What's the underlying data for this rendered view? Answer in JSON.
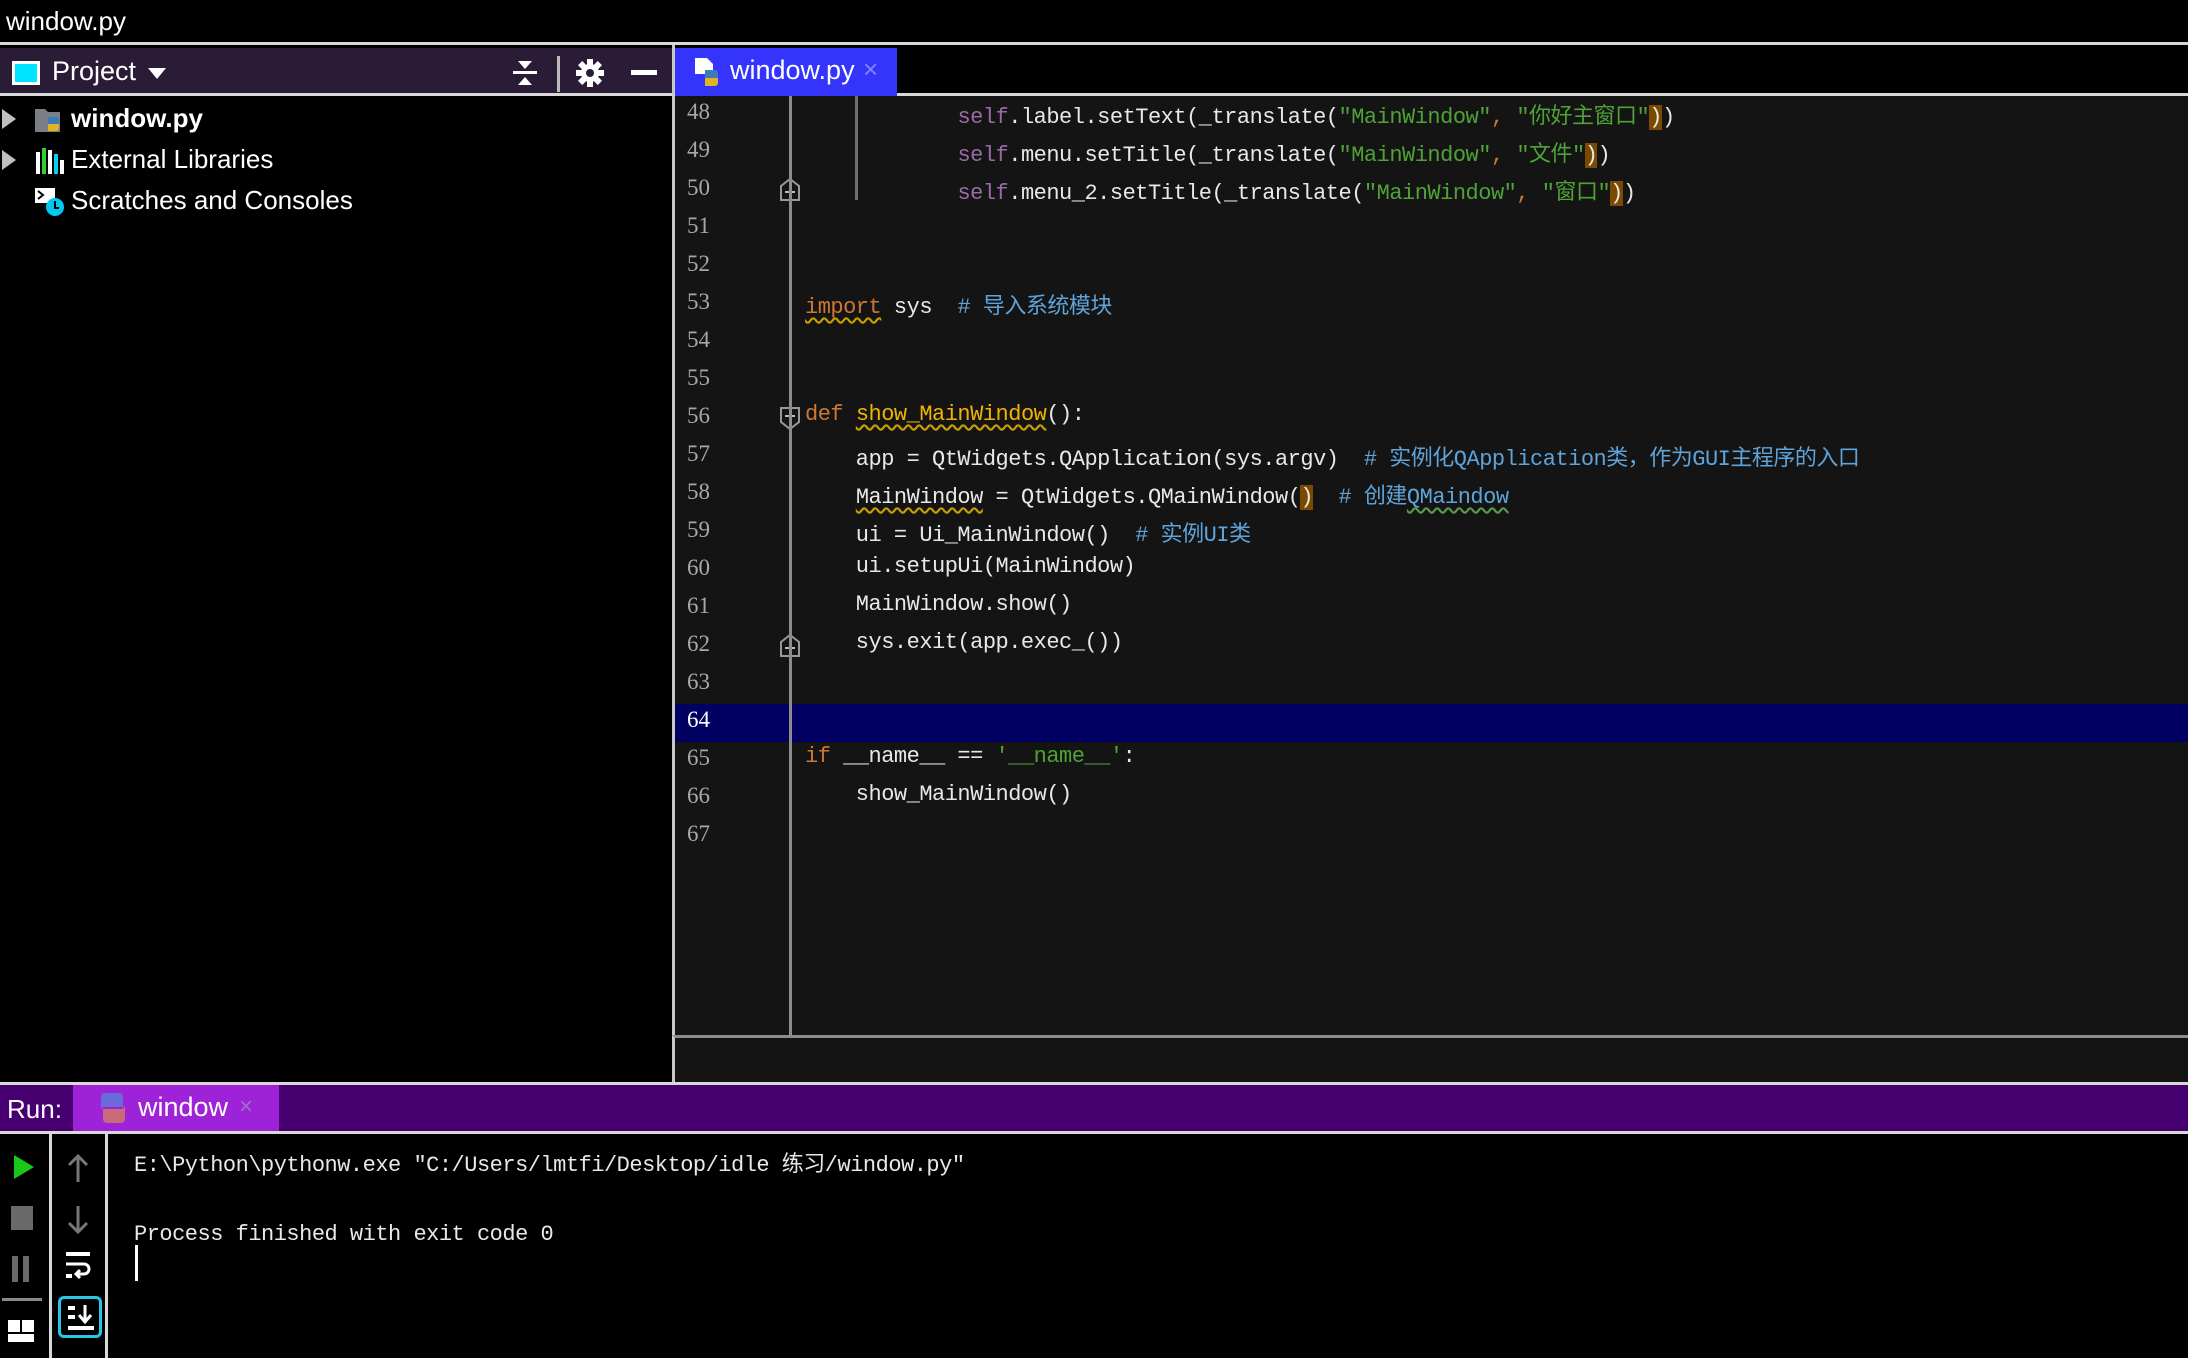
{
  "window": {
    "title": "window.py"
  },
  "project_panel": {
    "title": "Project",
    "icons": {
      "view": "project-view-icon",
      "dropdown": "chevron-down-icon",
      "collapse": "collapse-all-icon",
      "settings": "gear-icon",
      "hide": "minimize-icon"
    },
    "tree": [
      {
        "label": "window.py",
        "icon": "python-folder-icon",
        "expandable": true,
        "bold": true
      },
      {
        "label": "External Libraries",
        "icon": "libraries-icon",
        "expandable": true,
        "bold": false
      },
      {
        "label": "Scratches and Consoles",
        "icon": "scratches-icon",
        "expandable": false,
        "bold": false
      }
    ]
  },
  "editor": {
    "tab": {
      "label": "window.py",
      "icon": "python-file-icon",
      "close": "×"
    },
    "current_line": 64,
    "lines": [
      {
        "n": "48",
        "seg": [
          [
            "    ",
            ""
          ],
          [
            "        ",
            ""
          ],
          [
            "self",
            "c-self"
          ],
          [
            ".label.setText(_translate(",
            ""
          ],
          [
            "\"MainWindow\"",
            "c-str"
          ],
          [
            ", ",
            "c-punct"
          ],
          [
            "\"你好主窗口\"",
            "c-str"
          ],
          [
            ")",
            "hl-brace"
          ],
          [
            ")",
            ""
          ]
        ]
      },
      {
        "n": "49",
        "seg": [
          [
            "    ",
            ""
          ],
          [
            "        ",
            ""
          ],
          [
            "self",
            "c-self"
          ],
          [
            ".menu.setTitle(_translate(",
            ""
          ],
          [
            "\"MainWindow\"",
            "c-str"
          ],
          [
            ", ",
            "c-punct"
          ],
          [
            "\"文件\"",
            "c-str"
          ],
          [
            ")",
            "hl-brace"
          ],
          [
            ")",
            ""
          ]
        ]
      },
      {
        "n": "50",
        "seg": [
          [
            "    ",
            ""
          ],
          [
            "        ",
            ""
          ],
          [
            "self",
            "c-self"
          ],
          [
            ".menu_2.setTitle(_translate(",
            ""
          ],
          [
            "\"MainWindow\"",
            "c-str"
          ],
          [
            ", ",
            "c-punct"
          ],
          [
            "\"窗口\"",
            "c-str"
          ],
          [
            ")",
            "hl-brace"
          ],
          [
            ")",
            ""
          ]
        ]
      },
      {
        "n": "51",
        "seg": []
      },
      {
        "n": "52",
        "seg": []
      },
      {
        "n": "53",
        "seg": [
          [
            "import",
            "c-kw wavy-y"
          ],
          [
            " sys  ",
            ""
          ],
          [
            "# 导入系统模块",
            "c-com"
          ]
        ]
      },
      {
        "n": "54",
        "seg": []
      },
      {
        "n": "55",
        "seg": []
      },
      {
        "n": "56",
        "seg": [
          [
            "def",
            "c-kw"
          ],
          [
            " ",
            ""
          ],
          [
            "show_MainWindow",
            "c-fn wavy-y"
          ],
          [
            "():",
            ""
          ]
        ]
      },
      {
        "n": "57",
        "seg": [
          [
            "    app = QtWidgets.QApplication(sys.argv)  ",
            ""
          ],
          [
            "# 实例化QApplication类，作为GUI主程序的入口",
            "c-com"
          ]
        ]
      },
      {
        "n": "58",
        "seg": [
          [
            "    ",
            ""
          ],
          [
            "MainWindow",
            "wavy-y"
          ],
          [
            " = QtWidgets.QMainWindow(",
            ""
          ],
          [
            ")",
            "hl-brace"
          ],
          [
            "  ",
            ""
          ],
          [
            "# 创建",
            "c-com"
          ],
          [
            "QMaindow",
            "c-com wavy-g"
          ]
        ]
      },
      {
        "n": "59",
        "seg": [
          [
            "    ui = Ui_MainWindow()  ",
            ""
          ],
          [
            "# 实例UI类",
            "c-com"
          ]
        ]
      },
      {
        "n": "60",
        "seg": [
          [
            "    ui.setupUi(MainWindow)",
            ""
          ]
        ]
      },
      {
        "n": "61",
        "seg": [
          [
            "    MainWindow.show()",
            ""
          ]
        ]
      },
      {
        "n": "62",
        "seg": [
          [
            "    sys.exit(app.exec_())",
            ""
          ]
        ]
      },
      {
        "n": "63",
        "seg": []
      },
      {
        "n": "64",
        "seg": []
      },
      {
        "n": "65",
        "seg": [
          [
            "if",
            "c-kw"
          ],
          [
            " __name__ == ",
            ""
          ],
          [
            "'__name__'",
            "c-str"
          ],
          [
            ":",
            ""
          ]
        ]
      },
      {
        "n": "66",
        "seg": [
          [
            "    show_MainWindow()",
            ""
          ]
        ]
      },
      {
        "n": "67",
        "seg": []
      }
    ],
    "folds": [
      {
        "line": "50",
        "type": "end"
      },
      {
        "line": "56",
        "type": "start"
      },
      {
        "line": "62",
        "type": "end"
      }
    ]
  },
  "run_panel": {
    "label": "Run:",
    "tab": {
      "label": "window",
      "icon": "python-icon",
      "close": "×"
    },
    "tools_left": [
      "run-icon",
      "stop-icon",
      "pause-icon",
      "layout-icon"
    ],
    "tools_right": [
      "scroll-up-icon",
      "scroll-down-icon",
      "soft-wrap-icon",
      "scroll-to-end-icon"
    ],
    "console": [
      "E:\\Python\\pythonw.exe \"C:/Users/lmtfi/Desktop/idle 练习/window.py\"",
      "",
      "Process finished with exit code 0"
    ]
  },
  "colors": {
    "editor_bg": "#141414",
    "current_line": "#000062",
    "editor_tab": "#3434fc",
    "run_bar": "#470070",
    "run_tab": "#9d22d8",
    "project_header": "#2a1c36",
    "string": "#4fa236",
    "keyword": "#cc7832",
    "comment": "#5ea3d9",
    "self": "#9a6aa6"
  }
}
